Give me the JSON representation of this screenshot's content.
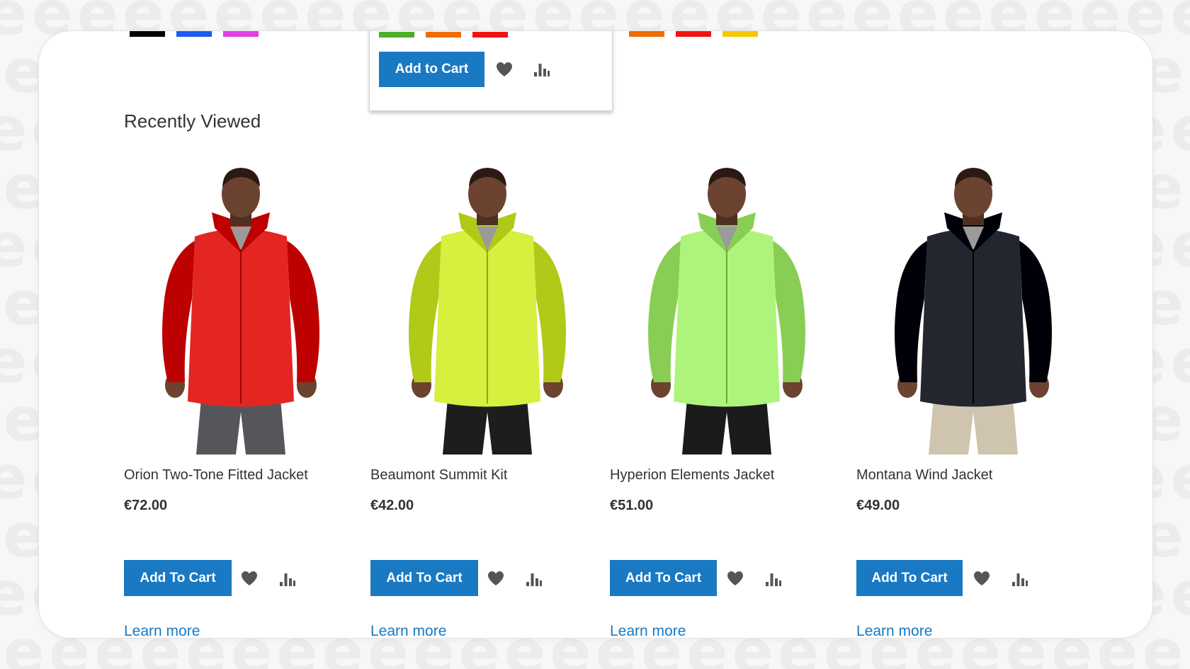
{
  "top_swatches": {
    "left": [
      "#000000",
      "#1e5af0",
      "#e040e8"
    ],
    "middle": [
      "#4caf2a",
      "#ef6c00",
      "#f01414"
    ],
    "right": [
      "#ef6c00",
      "#f01414",
      "#f5c800"
    ]
  },
  "popup": {
    "add_to_cart_label": "Add to Cart",
    "wishlist_icon": "heart-icon",
    "compare_icon": "bar-chart-icon"
  },
  "section": {
    "title": "Recently Viewed"
  },
  "colors": {
    "accent": "#1979c3",
    "text": "#333333",
    "card_background": "#ffffff",
    "page_background": "#f7f7f7"
  },
  "products": [
    {
      "name": "Orion Two-Tone Fitted Jacket",
      "price": "€72.00",
      "add_to_cart_label": "Add To Cart",
      "learn_more_label": "Learn more",
      "jacket_color": "#e32622",
      "pants_color": "#55565a",
      "wishlist_icon": "heart-icon",
      "compare_icon": "bar-chart-icon"
    },
    {
      "name": "Beaumont Summit Kit",
      "price": "€42.00",
      "add_to_cart_label": "Add To Cart",
      "learn_more_label": "Learn more",
      "jacket_color": "#d7ef3e",
      "pants_color": "#1d1d1d",
      "wishlist_icon": "heart-icon",
      "compare_icon": "bar-chart-icon"
    },
    {
      "name": "Hyperion Elements Jacket",
      "price": "€51.00",
      "add_to_cart_label": "Add To Cart",
      "learn_more_label": "Learn more",
      "jacket_color": "#aef47a",
      "pants_color": "#1b1b1b",
      "wishlist_icon": "heart-icon",
      "compare_icon": "bar-chart-icon"
    },
    {
      "name": "Montana Wind Jacket",
      "price": "€49.00",
      "add_to_cart_label": "Add To Cart",
      "learn_more_label": "Learn more",
      "jacket_color": "#23262f",
      "pants_color": "#cfc4ae",
      "wishlist_icon": "heart-icon",
      "compare_icon": "bar-chart-icon"
    }
  ]
}
